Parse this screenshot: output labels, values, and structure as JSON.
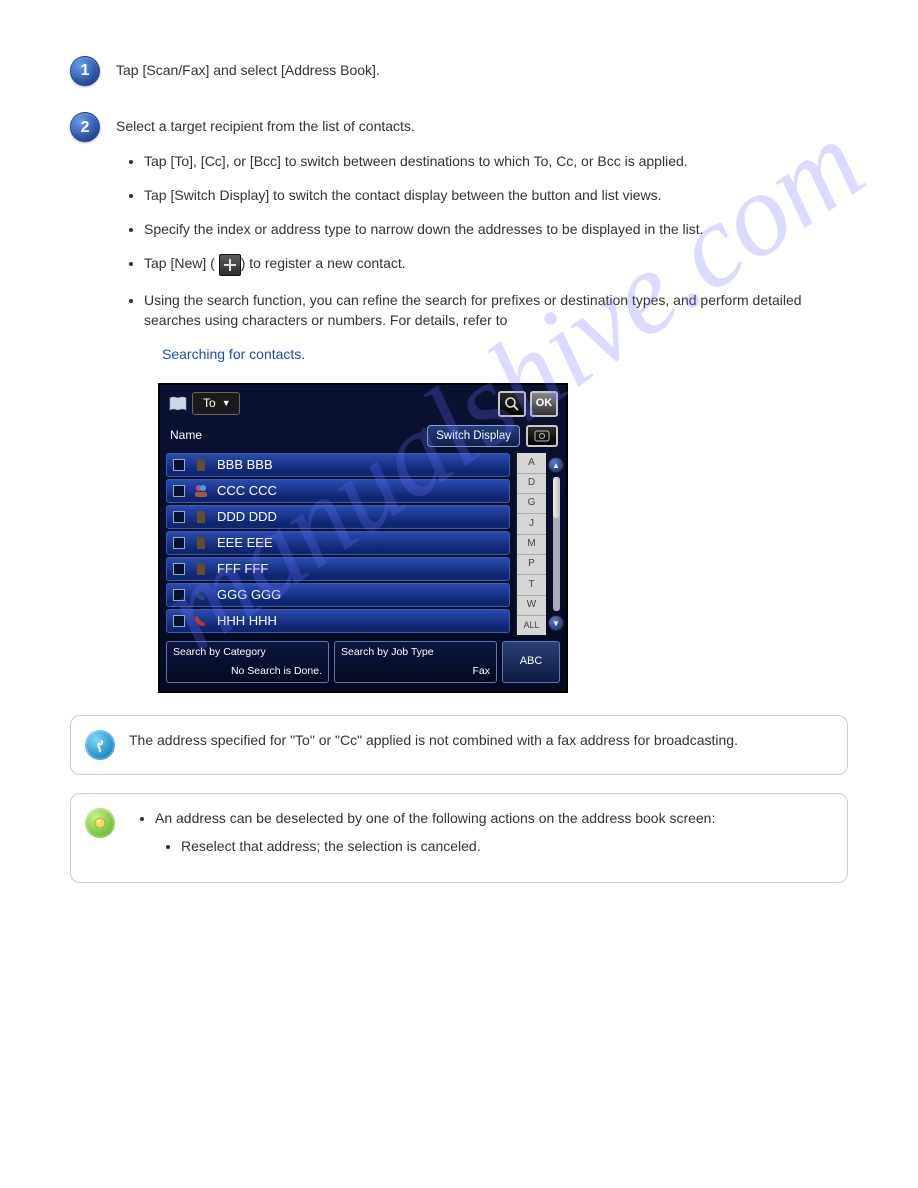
{
  "watermark": "manualshive.com",
  "steps": {
    "s1": {
      "num": "1",
      "text": "Tap [Scan/Fax] and select [Address Book]."
    },
    "s2": {
      "num": "2",
      "text": "Select a target recipient from the list of contacts.",
      "bullets": [
        "Tap [To], [Cc], or [Bcc] to switch between destinations to which To, Cc, or Bcc is applied.",
        "Tap [Switch Display] to switch the contact display between the button and list views.",
        "Specify the index or address type to narrow down the addresses to be displayed in the list.",
        "",
        "Using the search function, you can refine the search for prefixes or destination types, and perform detailed searches using characters or numbers. For details, refer to "
      ],
      "new_text": "Tap [New] (",
      "new_tail": ") to register a new contact.",
      "search_link": "Searching for contacts",
      "search_tail": "."
    }
  },
  "device": {
    "to_label": "To",
    "ok_label": "OK",
    "name_label": "Name",
    "switch_label": "Switch Display",
    "rows": [
      {
        "name": "BBB BBB"
      },
      {
        "name": "CCC CCC"
      },
      {
        "name": "DDD DDD"
      },
      {
        "name": "EEE EEE"
      },
      {
        "name": "FFF FFF"
      },
      {
        "name": "GGG GGG"
      },
      {
        "name": "HHH HHH"
      }
    ],
    "alpha": [
      "A",
      "D",
      "G",
      "J",
      "M",
      "P",
      "T",
      "W",
      "ALL"
    ],
    "search_cat_label": "Search by Category",
    "search_cat_val": "No Search is Done.",
    "search_job_label": "Search by Job Type",
    "search_job_val": "Fax",
    "abc_label": "ABC"
  },
  "notes": {
    "blue": {
      "text": "The address specified for \"To\" or \"Cc\" applied is not combined with a fax address for broadcasting."
    },
    "green": {
      "bullet": "An address can be deselected by one of the following actions on the address book screen:",
      "sub": "Reselect that address; the selection is canceled."
    }
  }
}
